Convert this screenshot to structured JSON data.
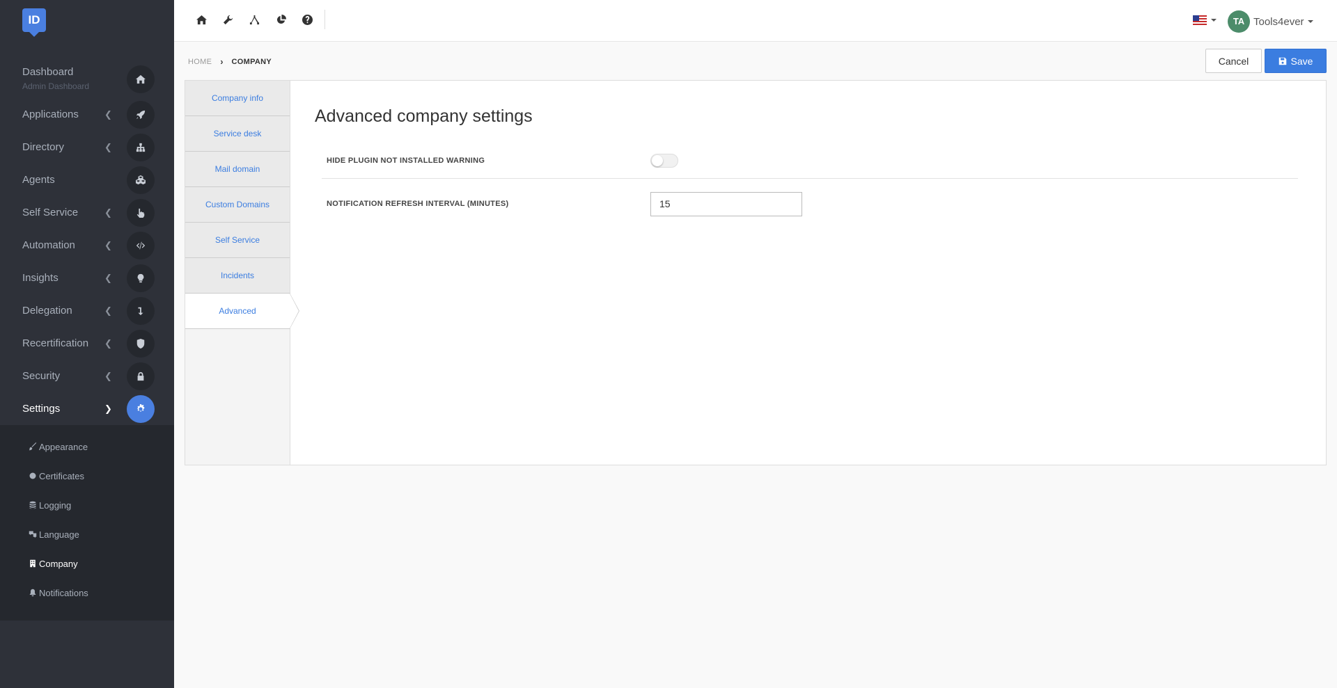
{
  "logo": {
    "text": "ID"
  },
  "sidebar": {
    "dashboard": {
      "label": "Dashboard",
      "sublabel": "Admin Dashboard"
    },
    "items": [
      {
        "label": "Applications",
        "icon": "rocket-icon"
      },
      {
        "label": "Directory",
        "icon": "sitemap-icon"
      },
      {
        "label": "Agents",
        "icon": "cubes-icon"
      },
      {
        "label": "Self Service",
        "icon": "hand-pointer-icon"
      },
      {
        "label": "Automation",
        "icon": "code-icon"
      },
      {
        "label": "Insights",
        "icon": "lightbulb-icon"
      },
      {
        "label": "Delegation",
        "icon": "level-down-icon"
      },
      {
        "label": "Recertification",
        "icon": "shield-icon"
      },
      {
        "label": "Security",
        "icon": "lock-icon"
      },
      {
        "label": "Settings",
        "icon": "gear-icon"
      }
    ],
    "submenu": [
      {
        "label": "Appearance"
      },
      {
        "label": "Certificates"
      },
      {
        "label": "Logging"
      },
      {
        "label": "Language"
      },
      {
        "label": "Company"
      },
      {
        "label": "Notifications"
      }
    ]
  },
  "topbar": {
    "user": {
      "initials": "TA",
      "name": "Tools4ever"
    },
    "accent_color": "#3b7de0"
  },
  "breadcrumb": {
    "home": "HOME",
    "current": "COMPANY"
  },
  "actions": {
    "cancel": "Cancel",
    "save": "Save"
  },
  "tabs": [
    "Company info",
    "Service desk",
    "Mail domain",
    "Custom Domains",
    "Self Service",
    "Incidents",
    "Advanced"
  ],
  "active_tab": "Advanced",
  "content": {
    "title": "Advanced company settings",
    "hide_plugin": {
      "label": "HIDE PLUGIN NOT INSTALLED WARNING",
      "enabled": false
    },
    "refresh_interval": {
      "label": "NOTIFICATION REFRESH INTERVAL (MINUTES)",
      "value": "15"
    }
  }
}
